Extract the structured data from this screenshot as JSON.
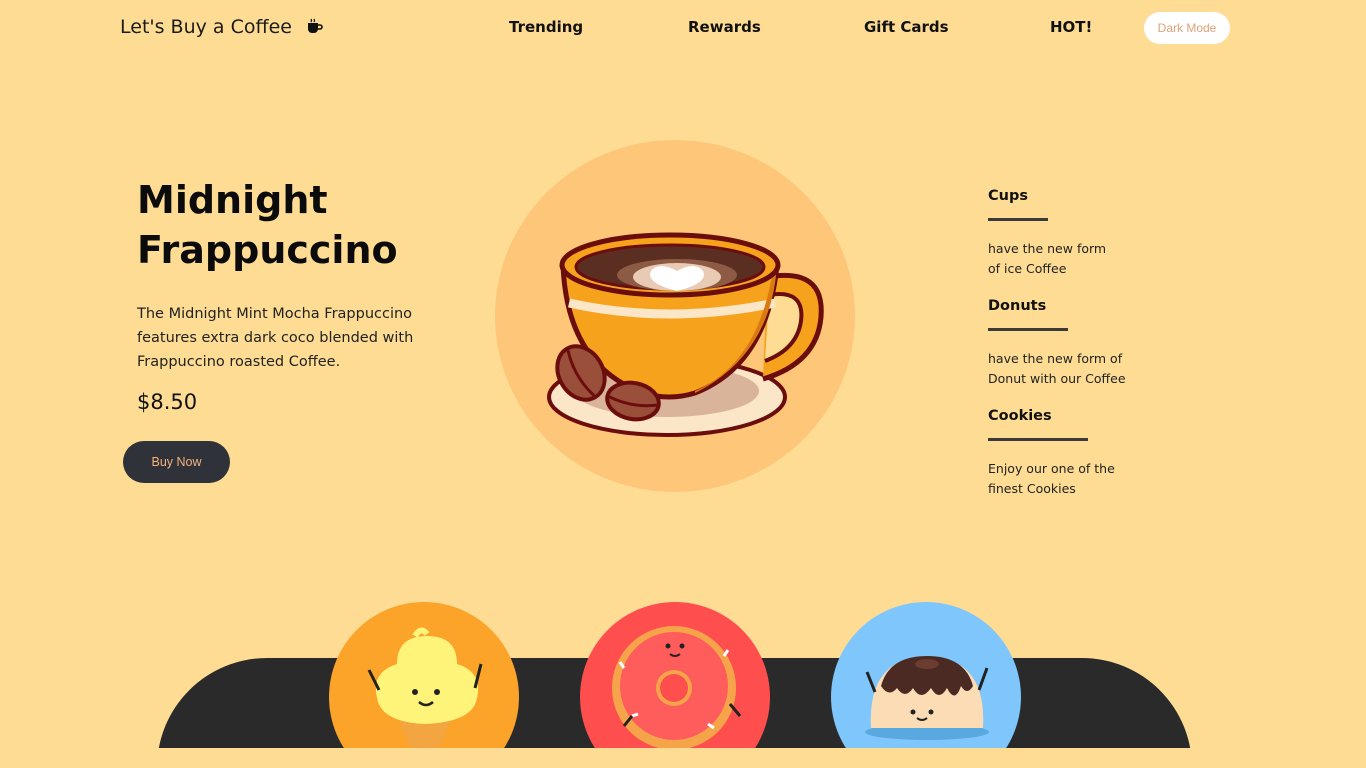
{
  "header": {
    "brand": "Let's Buy a Coffee",
    "brand_icon": "coffee-cup-icon",
    "nav": [
      "Trending",
      "Rewards",
      "Gift Cards",
      "HOT!"
    ],
    "dark_mode_label": "Dark Mode"
  },
  "hero": {
    "title_line1": "Midnight",
    "title_line2": "Frappuccino",
    "description": "The Midnight Mint Mocha Frappuccino features extra dark coco blended with Frappuccino roasted Coffee.",
    "price": "$8.50",
    "buy_label": "Buy Now",
    "image_icon": "coffee-cup-illustration"
  },
  "features": [
    {
      "title": "Cups",
      "text": "have the new form of ice Coffee"
    },
    {
      "title": "Donuts",
      "text": "have the new form of Donut with our Coffee"
    },
    {
      "title": "Cookies",
      "text": "Enjoy our one of the finest Cookies"
    }
  ],
  "products": [
    {
      "icon": "ice-cream-illustration"
    },
    {
      "icon": "donut-illustration"
    },
    {
      "icon": "pudding-illustration"
    }
  ],
  "colors": {
    "background": "#fedc93",
    "hero_circle": "#fec679",
    "buy_button": "#2f3238",
    "bottom_bar": "#2a2a2a",
    "product_1": "#fca42a",
    "product_2": "#ff4e4e",
    "product_3": "#7ec6fb"
  }
}
